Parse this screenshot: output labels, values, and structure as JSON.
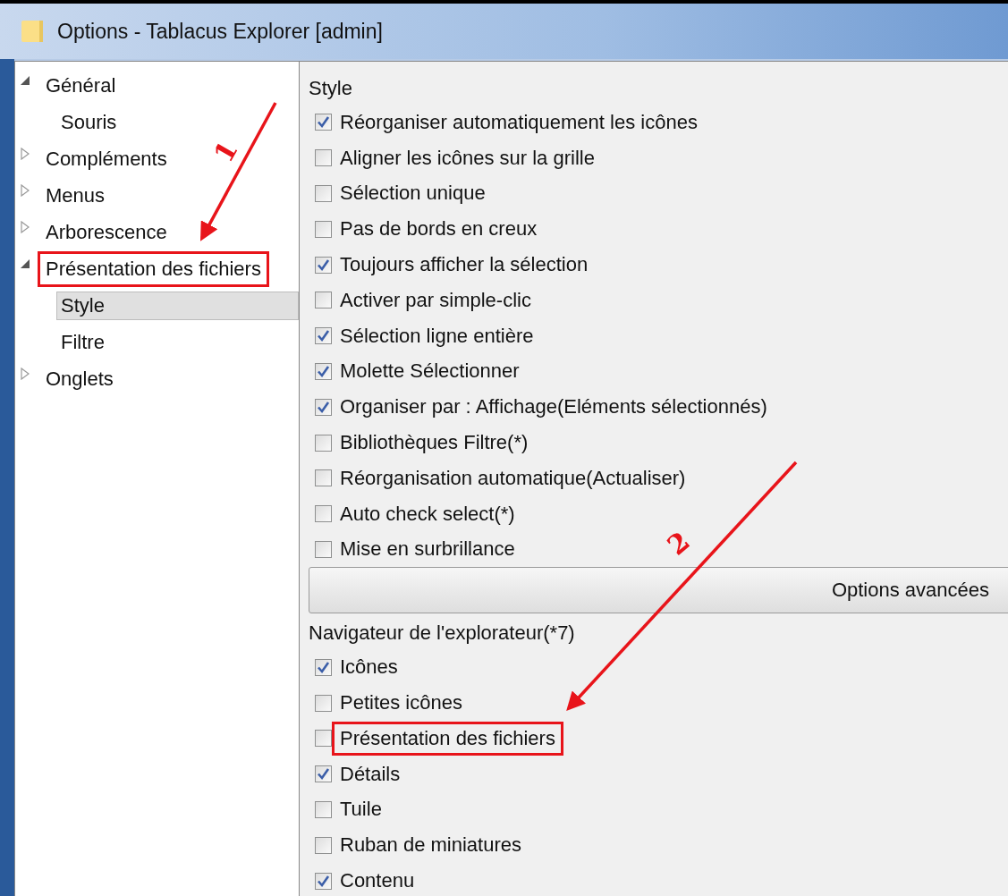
{
  "window": {
    "title": "Options - Tablacus Explorer [admin]"
  },
  "tree": [
    {
      "label": "Général",
      "expanded": true,
      "highlighted": false,
      "children": [
        {
          "label": "Souris",
          "selected": false
        }
      ]
    },
    {
      "label": "Compléments",
      "expanded": false,
      "highlighted": false
    },
    {
      "label": "Menus",
      "expanded": false,
      "highlighted": false
    },
    {
      "label": "Arborescence",
      "expanded": false,
      "highlighted": false
    },
    {
      "label": "Présentation des fichiers",
      "expanded": true,
      "highlighted": true,
      "children": [
        {
          "label": "Style",
          "selected": true
        },
        {
          "label": "Filtre",
          "selected": false
        }
      ]
    },
    {
      "label": "Onglets",
      "expanded": false,
      "highlighted": false
    }
  ],
  "sections": [
    {
      "title": "Style",
      "options": [
        {
          "label": "Réorganiser automatiquement les icônes",
          "checked": true,
          "highlighted": false
        },
        {
          "label": "Aligner les icônes sur la grille",
          "checked": false,
          "highlighted": false
        },
        {
          "label": "Sélection unique",
          "checked": false,
          "highlighted": false
        },
        {
          "label": "Pas de bords en creux",
          "checked": false,
          "highlighted": false
        },
        {
          "label": "Toujours afficher la sélection",
          "checked": true,
          "highlighted": false
        },
        {
          "label": "Activer par simple-clic",
          "checked": false,
          "highlighted": false
        },
        {
          "label": "Sélection ligne entière",
          "checked": true,
          "highlighted": false
        },
        {
          "label": "Molette Sélectionner",
          "checked": true,
          "highlighted": false
        },
        {
          "label": "Organiser par : Affichage(Eléments sélectionnés)",
          "checked": true,
          "highlighted": false
        },
        {
          "label": "Bibliothèques Filtre(*)",
          "checked": false,
          "highlighted": false
        },
        {
          "label": "Réorganisation automatique(Actualiser)",
          "checked": false,
          "highlighted": false
        },
        {
          "label": "Auto check select(*)",
          "checked": false,
          "highlighted": false
        },
        {
          "label": "Mise en surbrillance",
          "checked": false,
          "highlighted": false
        }
      ],
      "button": "Options avancées"
    },
    {
      "title": "Navigateur de l'explorateur(*7)",
      "options": [
        {
          "label": "Icônes",
          "checked": true,
          "highlighted": false
        },
        {
          "label": "Petites icônes",
          "checked": false,
          "highlighted": false
        },
        {
          "label": "Présentation des fichiers",
          "checked": false,
          "highlighted": true
        },
        {
          "label": "Détails",
          "checked": true,
          "highlighted": false
        },
        {
          "label": "Tuile",
          "checked": false,
          "highlighted": false
        },
        {
          "label": "Ruban de miniatures",
          "checked": false,
          "highlighted": false
        },
        {
          "label": "Contenu",
          "checked": true,
          "highlighted": false
        }
      ]
    }
  ],
  "annotations": [
    {
      "label": "1"
    },
    {
      "label": "2"
    }
  ]
}
